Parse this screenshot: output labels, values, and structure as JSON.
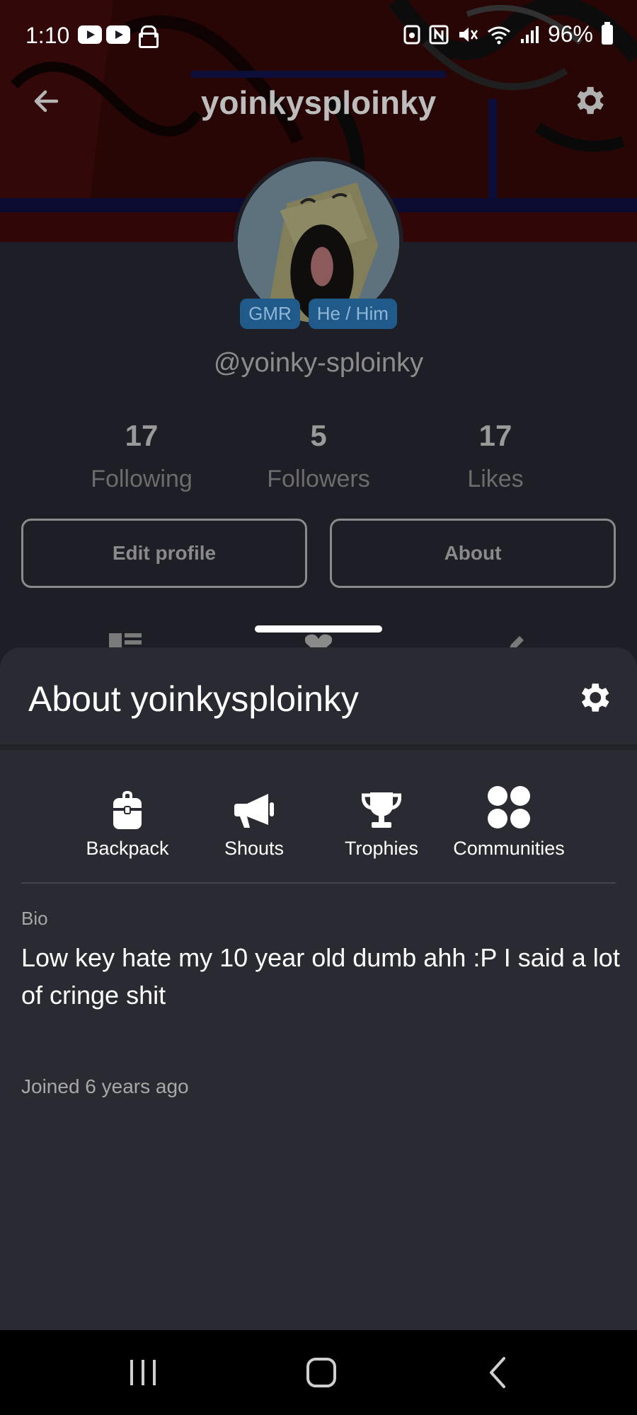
{
  "status_bar": {
    "time": "1:10",
    "battery": "96%",
    "left_icons": [
      "youtube-icon",
      "youtube-icon",
      "lock-icon"
    ],
    "right_icons": [
      "sim-icon",
      "nfc-icon",
      "mute-icon",
      "wifi-icon",
      "signal-icon",
      "battery-icon"
    ]
  },
  "profile": {
    "title": "yoinkysploinky",
    "tags": [
      "GMR",
      "He / Him"
    ],
    "handle": "@yoinky-sploinky",
    "stats": [
      {
        "value": "17",
        "label": "Following"
      },
      {
        "value": "5",
        "label": "Followers"
      },
      {
        "value": "17",
        "label": "Likes"
      }
    ],
    "buttons": {
      "edit": "Edit profile",
      "about": "About"
    }
  },
  "sheet": {
    "title": "About yoinkysploinky",
    "items": [
      {
        "label": "Backpack",
        "icon": "backpack-icon"
      },
      {
        "label": "Shouts",
        "icon": "megaphone-icon"
      },
      {
        "label": "Trophies",
        "icon": "trophy-icon"
      },
      {
        "label": "Communities",
        "icon": "communities-icon"
      }
    ],
    "bio_label": "Bio",
    "bio": "Low key hate my 10 year old dumb ahh :P I said a lot of cringe shit",
    "joined": "Joined 6 years ago"
  },
  "colors": {
    "sheet_bg": "#2a2a32",
    "page_bg": "#1d1e26",
    "tag_bg": "#1f5a8a"
  }
}
